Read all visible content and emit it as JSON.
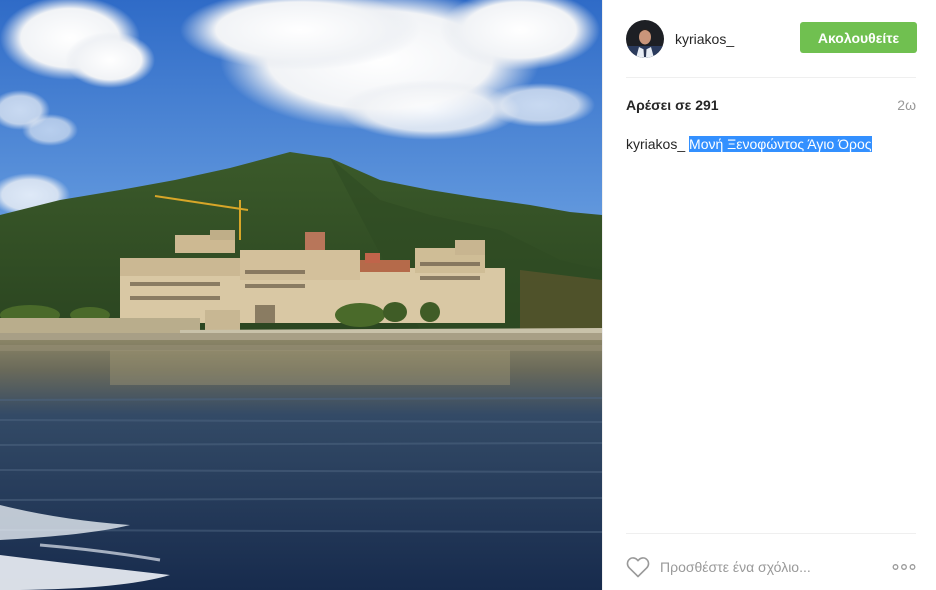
{
  "post": {
    "photo_icon": "monastery-photo",
    "user": {
      "username": "kyriakos_",
      "avatar_icon": "avatar-photo"
    },
    "follow_label": "Ακολουθείτε",
    "likes_text": "Αρέσει σε 291",
    "time_ago": "2ω",
    "caption": {
      "username": "kyriakos_",
      "text": "Μονή Ξενοφώντος Άγιο Όρος"
    },
    "comment": {
      "placeholder": "Προσθέστε ένα σχόλιο...",
      "value": ""
    },
    "icons": {
      "like": "heart-icon",
      "more": "more-options-icon"
    },
    "colors": {
      "follow_button": "#70c050",
      "selection_highlight": "#3390ff",
      "muted_text": "#999999"
    }
  }
}
